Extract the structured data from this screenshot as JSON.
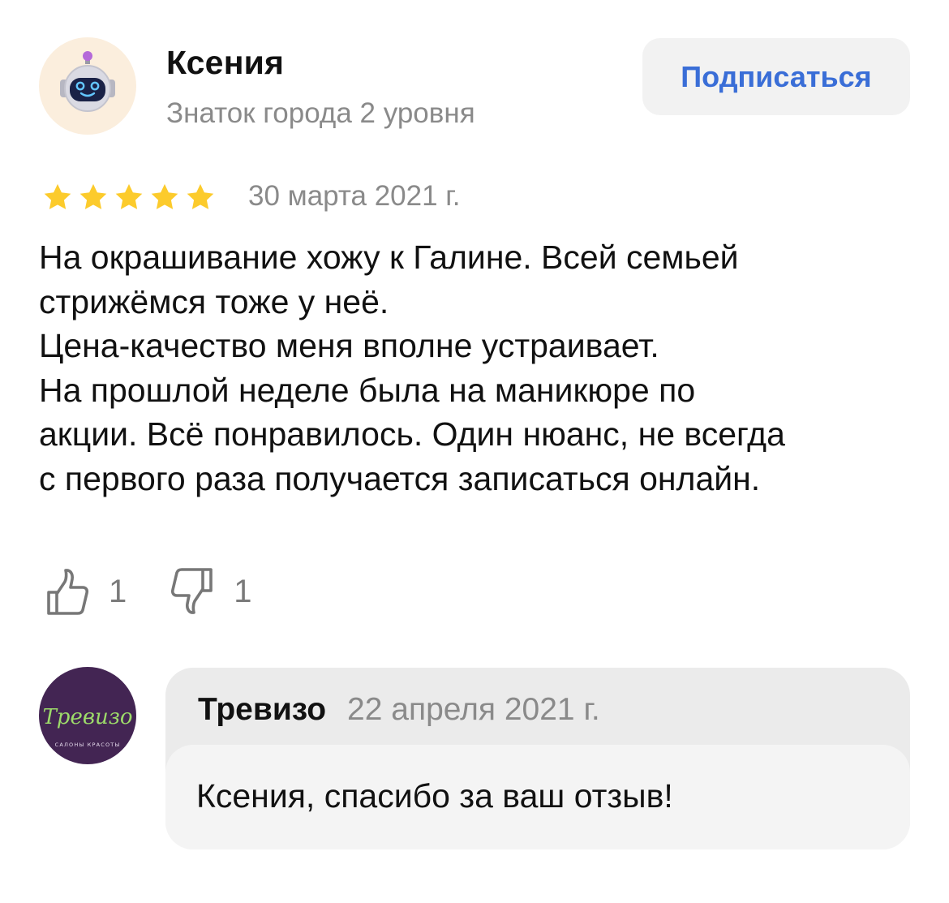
{
  "review": {
    "author": {
      "name": "Ксения",
      "level": "Знаток города 2 уровня",
      "avatar_icon": "robot-avatar-icon"
    },
    "subscribe_label": "Подписаться",
    "rating": 5,
    "date": "30 марта 2021 г.",
    "text_lines": [
      "На окрашивание хожу к Галине. Всей семьей",
      "стрижёмся тоже у неё.",
      "Цена-качество меня вполне устраивает.",
      "На прошлой неделе была на маникюре по",
      "акции. Всё понравилось. Один нюанс, не всегда",
      "с первого раза получается записаться онлайн."
    ],
    "likes": "1",
    "dislikes": "1"
  },
  "reply": {
    "org_name": "Тревизо",
    "date": "22 апреля 2021 г.",
    "text": "Ксения, спасибо за ваш отзыв!",
    "logo": {
      "script_text": "Тревизо",
      "tagline": "САЛОНЫ КРАСОТЫ"
    }
  },
  "colors": {
    "accent_blue": "#3a6ed7",
    "star": "#fccb2c",
    "muted": "#8a8a8a",
    "logo_bg": "#432553",
    "logo_green": "#9ddb6a"
  }
}
